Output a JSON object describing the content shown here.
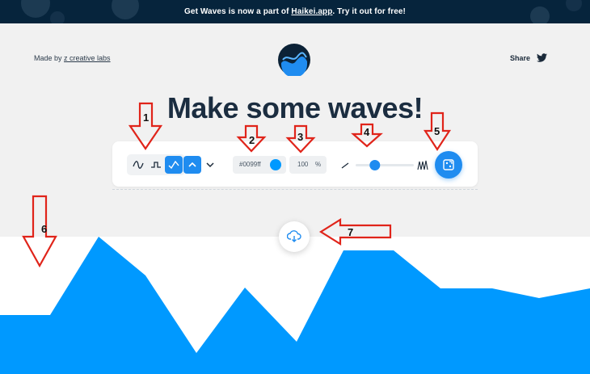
{
  "banner": {
    "prefix": "Get Waves is now a part of ",
    "link": "Haikei.app",
    "suffix": ". Try it out for free!"
  },
  "header": {
    "made_by_prefix": "Made by ",
    "made_by_brand": "z creative labs",
    "share_label": "Share",
    "share_icon": "twitter-icon",
    "logo_icon": "waves-logo-icon"
  },
  "headline": "Make some waves!",
  "toolbar": {
    "wave_types": [
      {
        "icon": "smooth-wave-icon",
        "active": false
      },
      {
        "icon": "step-wave-icon",
        "active": false
      },
      {
        "icon": "peak-wave-icon",
        "active": true
      }
    ],
    "direction": {
      "up_icon": "chevron-up-icon",
      "up_active": true,
      "down_icon": "chevron-down-icon"
    },
    "color": "#0099ff",
    "opacity": "100",
    "opacity_unit": "%",
    "complexity": {
      "low_icon": "flat-line-icon",
      "high_icon": "zigzag-icon",
      "level": 0.33
    },
    "randomize_icon": "randomize-icon"
  },
  "download_icon": "download-cloud-icon",
  "annotations": {
    "numbers": [
      "1",
      "2",
      "3",
      "4",
      "5",
      "6",
      "7"
    ],
    "arrow_color": "#e0241a"
  },
  "wave": {
    "fill": "#0099ff"
  }
}
